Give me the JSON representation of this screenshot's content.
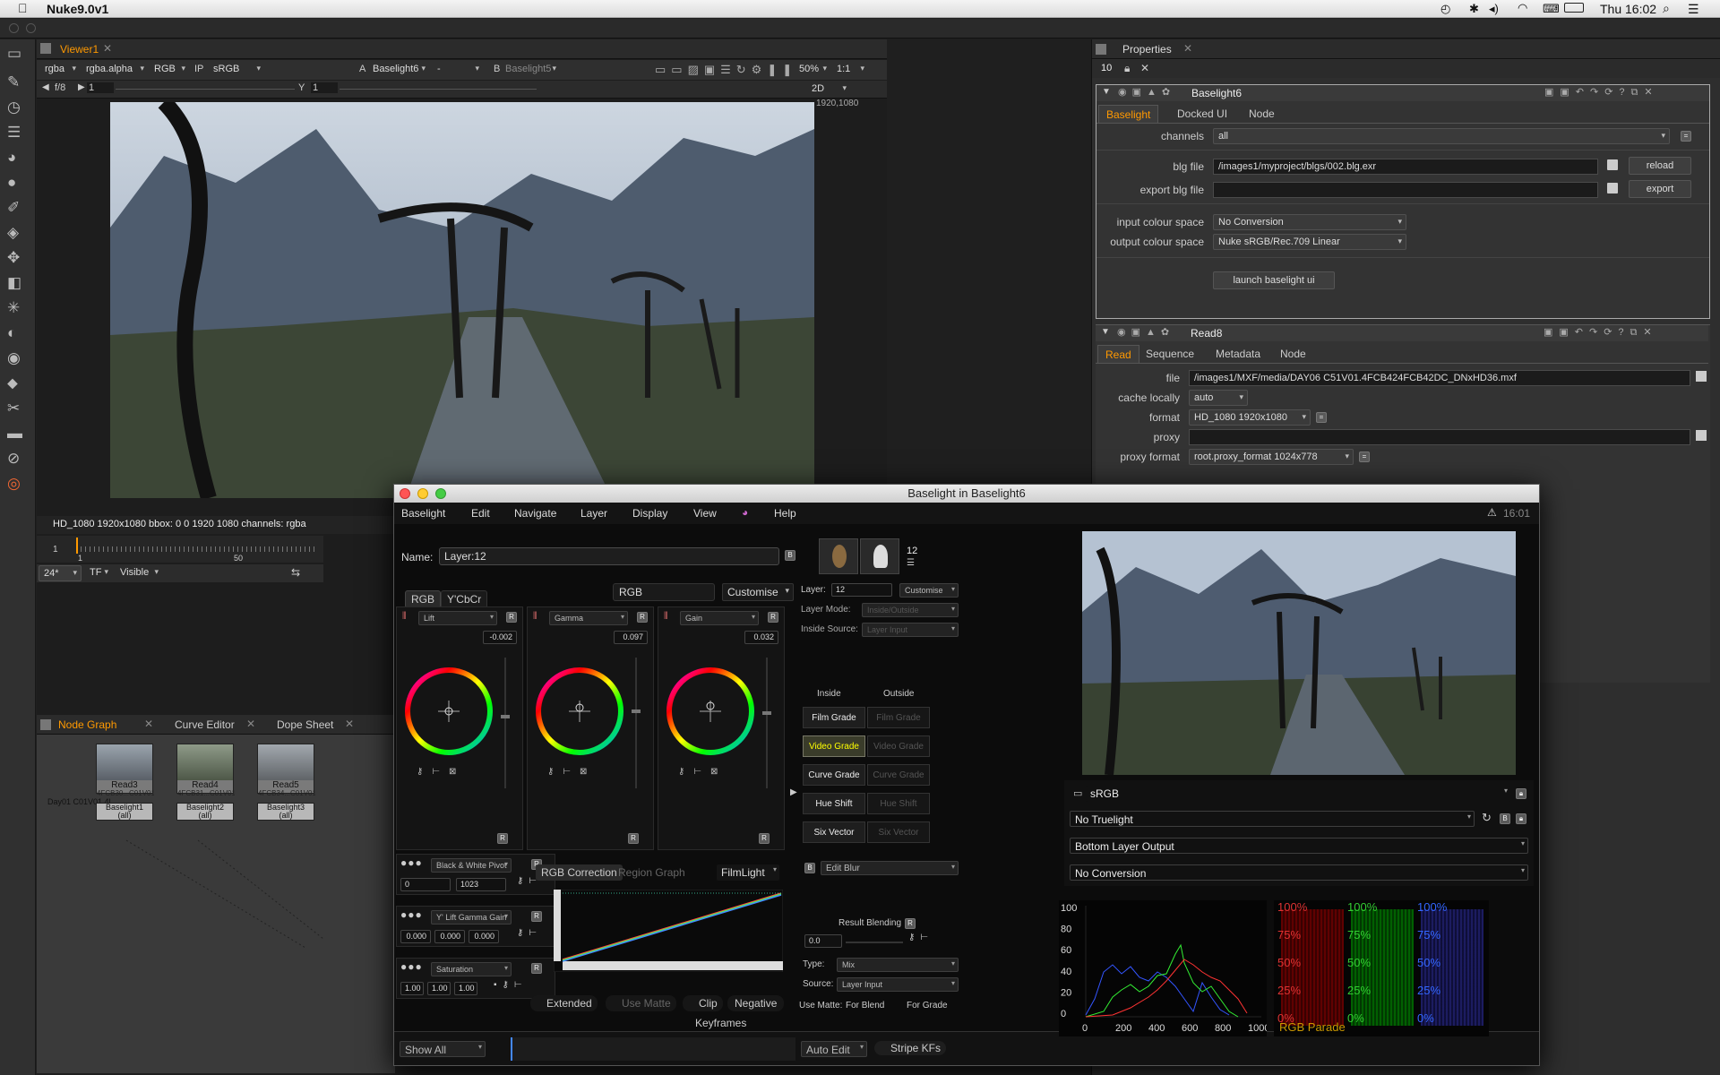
{
  "menubar": {
    "app": "Nuke9.0v1",
    "clock": "Thu 16:02"
  },
  "viewer": {
    "tab": "Viewer1",
    "toolbar": {
      "channels": "rgba",
      "alpha": "rgba.alpha",
      "rgb": "RGB",
      "ip": "IP",
      "lut": "sRGB",
      "a_label": "A",
      "a_input": "Baselight6",
      "a_op": "-",
      "b_label": "B",
      "b_input": "Baselight5",
      "zoom": "50%",
      "ratio": "1:1"
    },
    "row2": {
      "fstop": "f/8",
      "frame": "1",
      "y_label": "Y",
      "y_val": "1",
      "mode": "2D"
    },
    "resolution_label": "1920,1080",
    "info_bar": "HD_1080 1920x1080  bbox: 0 0 1920 1080 channels: rgba",
    "timeline": {
      "start": "1",
      "mark": "50",
      "fps": "24*",
      "tf": "TF",
      "visible": "Visible",
      "frame_tick": "1"
    }
  },
  "nodegraph": {
    "tabs": [
      "Node Graph",
      "Curve Editor",
      "Dope Sheet"
    ],
    "side_label": "Day01 C01V01.4FCB6...",
    "nodes": [
      {
        "read": "Read3",
        "grade": "Baselight1",
        "all": "(all)",
        "read_sub": "4FCB30...C01V01.4FCB..."
      },
      {
        "read": "Read4",
        "grade": "Baselight2",
        "all": "(all)",
        "read_sub": "4FCB31...C01V01..."
      },
      {
        "read": "Read5",
        "grade": "Baselight3",
        "all": "(all)",
        "read_sub": "4FCB34...C01V01.4F..."
      }
    ]
  },
  "properties": {
    "tab": "Properties",
    "max_panels": "10",
    "bl_panel": {
      "title": "Baselight6",
      "tabs": [
        "Baselight",
        "Docked UI",
        "Node"
      ],
      "channels_label": "channels",
      "channels": "all",
      "blg_label": "blg file",
      "blg": "/images1/myproject/blgs/002.blg.exr",
      "reload": "reload",
      "export_label": "export blg file",
      "export_blg": "",
      "export": "export",
      "in_cs_label": "input colour space",
      "in_cs": "No Conversion",
      "out_cs_label": "output colour space",
      "out_cs": "Nuke sRGB/Rec.709 Linear",
      "launch": "launch baselight ui"
    },
    "read_panel": {
      "title": "Read8",
      "tabs": [
        "Read",
        "Sequence",
        "Metadata",
        "Node"
      ],
      "file_label": "file",
      "file": "/images1/MXF/media/DAY06 C51V01.4FCB424FCB42DC_DNxHD36.mxf",
      "cache_label": "cache locally",
      "cache": "auto",
      "format_label": "format",
      "format": "HD_1080 1920x1080",
      "proxy_label": "proxy",
      "proxy": "",
      "proxy_format_label": "proxy format",
      "proxy_format": "root.proxy_format 1024x778"
    }
  },
  "baselight": {
    "title": "Baselight in Baselight6",
    "menu": [
      "Baselight",
      "Edit",
      "Navigate",
      "Layer",
      "Display",
      "View",
      "Help"
    ],
    "time": "16:01",
    "name_label": "Name:",
    "name": "Layer:12",
    "layer_count": "12",
    "mode_tabs": [
      "RGB",
      "Y'CbCr"
    ],
    "colour_mode": "RGB",
    "customise": "Customise",
    "wheels": [
      {
        "name": "Lift",
        "value": "-0.002"
      },
      {
        "name": "Gamma",
        "value": "0.097"
      },
      {
        "name": "Gain",
        "value": "0.032"
      }
    ],
    "bw_pivot": {
      "label": "Black & White Pivot",
      "v1": "0",
      "v2": "1023"
    },
    "lgg": {
      "label": "Y' Lift Gamma Gain",
      "v1": "0.000",
      "v2": "0.000",
      "v3": "0.000"
    },
    "sat": {
      "label": "Saturation",
      "v1": "1.00",
      "v2": "1.00",
      "v3": "1.00"
    },
    "curve_tabs": [
      "RGB Correction",
      "Region Graph"
    ],
    "curve_preset": "FilmLight",
    "curve_opts": [
      "Extended",
      "Use Matte",
      "Clip",
      "Negative"
    ],
    "layer": {
      "label": "Layer:",
      "value": "12",
      "customise": "Customise",
      "mode_label": "Layer Mode:",
      "mode": "Inside/Outside",
      "src_label": "Inside Source:",
      "src": "Layer Input"
    },
    "inside": "Inside",
    "outside": "Outside",
    "ops": [
      "Film Grade",
      "Video Grade",
      "Curve Grade",
      "Hue Shift",
      "Six Vector"
    ],
    "edit_blur": "Edit Blur",
    "blend": {
      "title": "Result Blending",
      "value": "0.0",
      "type_label": "Type:",
      "type": "Mix",
      "src_label": "Source:",
      "src": "Layer Input",
      "matte_label": "Use Matte:",
      "for_blend": "For Blend",
      "for_grade": "For Grade"
    },
    "keyframes": {
      "label": "Keyframes",
      "show": "Show All",
      "auto": "Auto Edit",
      "stripe": "Stripe KFs"
    },
    "display": {
      "cs": "sRGB",
      "truelight": "No Truelight",
      "output": "Bottom Layer Output",
      "conversion": "No Conversion"
    },
    "scope": {
      "y_ticks": [
        "100",
        "80",
        "60",
        "40",
        "20",
        "0"
      ],
      "x_ticks": [
        "0",
        "200",
        "400",
        "600",
        "800",
        "1000"
      ],
      "parade_pcts": [
        "100%",
        "75%",
        "50%",
        "25%",
        "0%"
      ],
      "parade_label": "RGB Parade"
    }
  }
}
